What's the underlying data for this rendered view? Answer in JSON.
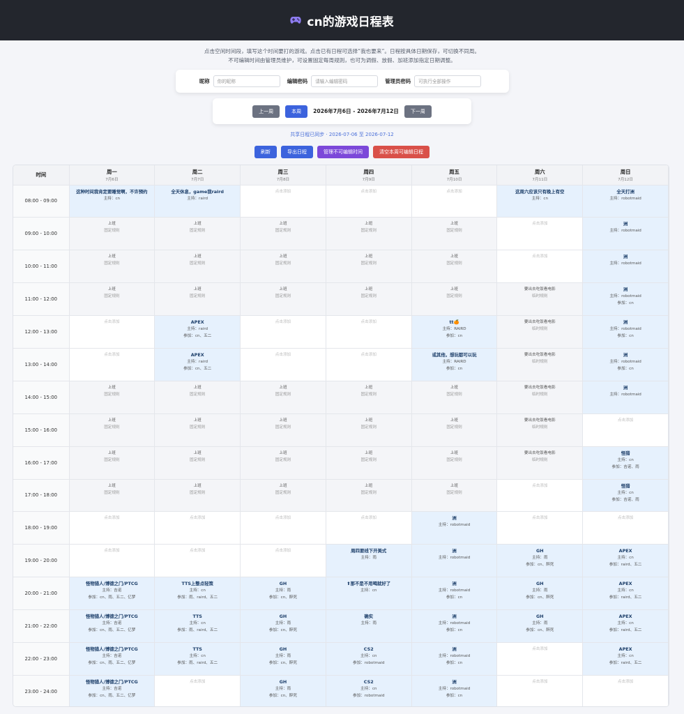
{
  "header": {
    "title": "cn的游戏日程表"
  },
  "intro": {
    "line1": "点击空闲时间段，填写这个时间要打的游戏。点击已有日程可选择“我也要来”。日程按具体日期保存，可切换不同周。",
    "line2": "不可编辑时间由管理员维护，可设置固定每周规则，也可为调假、放假、加班添加指定日期调整。"
  },
  "auth": {
    "nickname_label": "昵称",
    "nickname_placeholder": "你的昵称",
    "edit_label": "编辑密码",
    "edit_placeholder": "请输入编辑密码",
    "admin_label": "管理员密码",
    "admin_placeholder": "可执行全部操作"
  },
  "weeknav": {
    "prev": "上一周",
    "this": "本周",
    "range": "2026年7月6日 - 2026年7月12日",
    "next": "下一周"
  },
  "sync": "共享日程已同步 · 2026-07-06 至 2026-07-12",
  "actions": {
    "refresh": "刷新",
    "export": "导出日程",
    "manage": "管理不可编辑时间",
    "clear": "清空本周可编辑日程"
  },
  "colors": {
    "topbar": "#23262d",
    "primary": "#3c63dd",
    "purple": "#7c48d9",
    "danger": "#d95049",
    "booked": "#e6f1fd",
    "fixed": "#f4f5f8"
  },
  "grid": {
    "time_header": "时间",
    "days": [
      {
        "name": "周一",
        "date": "7月6日"
      },
      {
        "name": "周二",
        "date": "7月7日"
      },
      {
        "name": "周三",
        "date": "7月8日"
      },
      {
        "name": "周四",
        "date": "7月9日"
      },
      {
        "name": "周五",
        "date": "7月10日"
      },
      {
        "name": "周六",
        "date": "7月11日"
      },
      {
        "name": "周日",
        "date": "7月12日"
      }
    ],
    "rows": [
      {
        "time": "08:00 - 09:00",
        "cells": [
          {
            "type": "booked",
            "title": "这种时间我肯定要睡觉啊，不许预约",
            "host": "主持：cn"
          },
          {
            "type": "booked",
            "title": "全天休息，game我raird",
            "host": "主持：raird"
          },
          {
            "type": "empty",
            "text": "点击添加"
          },
          {
            "type": "empty",
            "text": "点击添加"
          },
          {
            "type": "empty",
            "text": "点击添加"
          },
          {
            "type": "booked",
            "title": "这周六应该只有晚上有空",
            "host": "主持：cn"
          },
          {
            "type": "booked",
            "title": "全天打洲",
            "host": "主持：robotmaid"
          }
        ]
      },
      {
        "time": "09:00 - 10:00",
        "cells": [
          {
            "type": "fixed",
            "title": "上班",
            "sub": "固定规则"
          },
          {
            "type": "fixed",
            "title": "上班",
            "sub": "固定规则"
          },
          {
            "type": "fixed",
            "title": "上班",
            "sub": "固定规则"
          },
          {
            "type": "fixed",
            "title": "上班",
            "sub": "固定规则"
          },
          {
            "type": "fixed",
            "title": "上班",
            "sub": "固定规则"
          },
          {
            "type": "empty",
            "text": "点击添加"
          },
          {
            "type": "booked",
            "title": "洲",
            "host": "主持：robotmaid"
          }
        ]
      },
      {
        "time": "10:00 - 11:00",
        "cells": [
          {
            "type": "fixed",
            "title": "上班",
            "sub": "固定规则"
          },
          {
            "type": "fixed",
            "title": "上班",
            "sub": "固定规则"
          },
          {
            "type": "fixed",
            "title": "上班",
            "sub": "固定规则"
          },
          {
            "type": "fixed",
            "title": "上班",
            "sub": "固定规则"
          },
          {
            "type": "fixed",
            "title": "上班",
            "sub": "固定规则"
          },
          {
            "type": "empty",
            "text": "点击添加"
          },
          {
            "type": "booked",
            "title": "洲",
            "host": "主持：robotmaid"
          }
        ]
      },
      {
        "time": "11:00 - 12:00",
        "cells": [
          {
            "type": "fixed",
            "title": "上班",
            "sub": "固定规则"
          },
          {
            "type": "fixed",
            "title": "上班",
            "sub": "固定规则"
          },
          {
            "type": "fixed",
            "title": "上班",
            "sub": "固定规则"
          },
          {
            "type": "fixed",
            "title": "上班",
            "sub": "固定规则"
          },
          {
            "type": "fixed",
            "title": "上班",
            "sub": "固定规则"
          },
          {
            "type": "fixed",
            "title": "要出去吃饭看电影",
            "sub": "临时规则"
          },
          {
            "type": "booked",
            "title": "洲",
            "host": "主持：robotmaid",
            "join": "参加：cn"
          }
        ]
      },
      {
        "time": "12:00 - 13:00",
        "cells": [
          {
            "type": "empty",
            "text": "点击添加"
          },
          {
            "type": "booked",
            "title": "APEX",
            "host": "主持：raird",
            "join": "参加：cn、五二"
          },
          {
            "type": "empty",
            "text": "点击添加"
          },
          {
            "type": "empty",
            "text": "点击添加"
          },
          {
            "type": "booked",
            "title": "tt🍊",
            "host": "主持：RAIRD",
            "join": "参加：cn"
          },
          {
            "type": "fixed",
            "title": "要出去吃饭看电影",
            "sub": "临时规则"
          },
          {
            "type": "booked",
            "title": "洲",
            "host": "主持：robotmaid",
            "join": "参加：cn"
          }
        ]
      },
      {
        "time": "13:00 - 14:00",
        "cells": [
          {
            "type": "empty",
            "text": "点击添加"
          },
          {
            "type": "booked",
            "title": "APEX",
            "host": "主持：raird",
            "join": "参加：cn、五二"
          },
          {
            "type": "empty",
            "text": "点击添加"
          },
          {
            "type": "empty",
            "text": "点击添加"
          },
          {
            "type": "booked",
            "title": "或其他，想玩都可以玩",
            "host": "主持：RAIRD",
            "join": "参加：cn"
          },
          {
            "type": "fixed",
            "title": "要出去吃饭看电影",
            "sub": "临时规则"
          },
          {
            "type": "booked",
            "title": "洲",
            "host": "主持：robotmaid",
            "join": "参加：cn"
          }
        ]
      },
      {
        "time": "14:00 - 15:00",
        "cells": [
          {
            "type": "fixed",
            "title": "上班",
            "sub": "固定规则"
          },
          {
            "type": "fixed",
            "title": "上班",
            "sub": "固定规则"
          },
          {
            "type": "fixed",
            "title": "上班",
            "sub": "固定规则"
          },
          {
            "type": "fixed",
            "title": "上班",
            "sub": "固定规则"
          },
          {
            "type": "fixed",
            "title": "上班",
            "sub": "固定规则"
          },
          {
            "type": "fixed",
            "title": "要出去吃饭看电影",
            "sub": "临时规则"
          },
          {
            "type": "booked",
            "title": "洲",
            "host": "主持：robotmaid"
          }
        ]
      },
      {
        "time": "15:00 - 16:00",
        "cells": [
          {
            "type": "fixed",
            "title": "上班",
            "sub": "固定规则"
          },
          {
            "type": "fixed",
            "title": "上班",
            "sub": "固定规则"
          },
          {
            "type": "fixed",
            "title": "上班",
            "sub": "固定规则"
          },
          {
            "type": "fixed",
            "title": "上班",
            "sub": "固定规则"
          },
          {
            "type": "fixed",
            "title": "上班",
            "sub": "固定规则"
          },
          {
            "type": "fixed",
            "title": "要出去吃饭看电影",
            "sub": "临时规则"
          },
          {
            "type": "empty",
            "text": "点击添加"
          }
        ]
      },
      {
        "time": "16:00 - 17:00",
        "cells": [
          {
            "type": "fixed",
            "title": "上班",
            "sub": "固定规则"
          },
          {
            "type": "fixed",
            "title": "上班",
            "sub": "固定规则"
          },
          {
            "type": "fixed",
            "title": "上班",
            "sub": "固定规则"
          },
          {
            "type": "fixed",
            "title": "上班",
            "sub": "固定规则"
          },
          {
            "type": "fixed",
            "title": "上班",
            "sub": "固定规则"
          },
          {
            "type": "fixed",
            "title": "要出去吃饭看电影",
            "sub": "临时规则"
          },
          {
            "type": "booked",
            "title": "怪猎",
            "host": "主持：cn",
            "join": "参加：吉诺、雨"
          }
        ]
      },
      {
        "time": "17:00 - 18:00",
        "cells": [
          {
            "type": "fixed",
            "title": "上班",
            "sub": "固定规则"
          },
          {
            "type": "fixed",
            "title": "上班",
            "sub": "固定规则"
          },
          {
            "type": "fixed",
            "title": "上班",
            "sub": "固定规则"
          },
          {
            "type": "fixed",
            "title": "上班",
            "sub": "固定规则"
          },
          {
            "type": "fixed",
            "title": "上班",
            "sub": "固定规则"
          },
          {
            "type": "empty",
            "text": "点击添加"
          },
          {
            "type": "booked",
            "title": "怪猎",
            "host": "主持：cn",
            "join": "参加：吉诺、雨"
          }
        ]
      },
      {
        "time": "18:00 - 19:00",
        "cells": [
          {
            "type": "empty",
            "text": "点击添加"
          },
          {
            "type": "empty",
            "text": "点击添加"
          },
          {
            "type": "empty",
            "text": "点击添加"
          },
          {
            "type": "empty",
            "text": "点击添加"
          },
          {
            "type": "booked",
            "title": "洲",
            "host": "主持：robotmaid"
          },
          {
            "type": "empty",
            "text": "点击添加"
          },
          {
            "type": "empty",
            "text": "点击添加"
          }
        ]
      },
      {
        "time": "19:00 - 20:00",
        "cells": [
          {
            "type": "empty",
            "text": "点击添加"
          },
          {
            "type": "empty",
            "text": "点击添加"
          },
          {
            "type": "empty",
            "text": "点击添加"
          },
          {
            "type": "booked",
            "title": "周四要线下开美式",
            "host": "主持：雨"
          },
          {
            "type": "booked",
            "title": "洲",
            "host": "主持：robotmaid"
          },
          {
            "type": "booked",
            "title": "GH",
            "host": "主持：雨",
            "join": "参加：cn、醉死"
          },
          {
            "type": "booked",
            "title": "APEX",
            "host": "主持：cn",
            "join": "参加：raird、五二"
          }
        ]
      },
      {
        "time": "20:00 - 21:00",
        "cells": [
          {
            "type": "booked",
            "title": "怪物猎人/博德之门/PTCG",
            "host": "主持：吉诺",
            "join": "参加：cn、雨、五二、亿梦"
          },
          {
            "type": "booked",
            "title": "TTS上整点轻策",
            "host": "主持：cn",
            "join": "参加：雨、raird、五二"
          },
          {
            "type": "booked",
            "title": "GH",
            "host": "主持：雨",
            "join": "参加：cn、醉死"
          },
          {
            "type": "booked",
            "title": "⬆那不是不用喝就好了",
            "host": "主持：cn"
          },
          {
            "type": "booked",
            "title": "洲",
            "host": "主持：robotmaid",
            "join": "参加：cn"
          },
          {
            "type": "booked",
            "title": "GH",
            "host": "主持：雨",
            "join": "参加：cn、醉死"
          },
          {
            "type": "booked",
            "title": "APEX",
            "host": "主持：cn",
            "join": "参加：raird、五二"
          }
        ]
      },
      {
        "time": "21:00 - 22:00",
        "cells": [
          {
            "type": "booked",
            "title": "怪物猎人/博德之门/PTCG",
            "host": "主持：吉诺",
            "join": "参加：cn、雨、五二、亿梦"
          },
          {
            "type": "booked",
            "title": "TTS",
            "host": "主持：cn",
            "join": "参加：雨、raird、五二"
          },
          {
            "type": "booked",
            "title": "GH",
            "host": "主持：雨",
            "join": "参加：cn、醉死"
          },
          {
            "type": "booked",
            "title": "确实",
            "host": "主持：雨"
          },
          {
            "type": "booked",
            "title": "洲",
            "host": "主持：robotmaid",
            "join": "参加：cn"
          },
          {
            "type": "booked",
            "title": "GH",
            "host": "主持：雨",
            "join": "参加：cn、醉死"
          },
          {
            "type": "booked",
            "title": "APEX",
            "host": "主持：cn",
            "join": "参加：raird、五二"
          }
        ]
      },
      {
        "time": "22:00 - 23:00",
        "cells": [
          {
            "type": "booked",
            "title": "怪物猎人/博德之门/PTCG",
            "host": "主持：吉诺",
            "join": "参加：cn、雨、五二、亿梦"
          },
          {
            "type": "booked",
            "title": "TTS",
            "host": "主持：cn",
            "join": "参加：雨、raird、五二"
          },
          {
            "type": "booked",
            "title": "GH",
            "host": "主持：雨",
            "join": "参加：cn、醉死"
          },
          {
            "type": "booked",
            "title": "CS2",
            "host": "主持：cn",
            "join": "参加：robotmaid"
          },
          {
            "type": "booked",
            "title": "洲",
            "host": "主持：robotmaid",
            "join": "参加：cn"
          },
          {
            "type": "empty",
            "text": "点击添加"
          },
          {
            "type": "booked",
            "title": "APEX",
            "host": "主持：cn",
            "join": "参加：raird、五二"
          }
        ]
      },
      {
        "time": "23:00 - 24:00",
        "cells": [
          {
            "type": "booked",
            "title": "怪物猎人/博德之门/PTCG",
            "host": "主持：吉诺",
            "join": "参加：cn、雨、五二、亿梦"
          },
          {
            "type": "empty",
            "text": "点击添加"
          },
          {
            "type": "booked",
            "title": "GH",
            "host": "主持：雨",
            "join": "参加：cn、醉死"
          },
          {
            "type": "booked",
            "title": "CS2",
            "host": "主持：cn",
            "join": "参加：robotmaid"
          },
          {
            "type": "booked",
            "title": "洲",
            "host": "主持：robotmaid",
            "join": "参加：cn"
          },
          {
            "type": "empty",
            "text": "点击添加"
          },
          {
            "type": "empty",
            "text": "点击添加"
          }
        ]
      }
    ]
  }
}
